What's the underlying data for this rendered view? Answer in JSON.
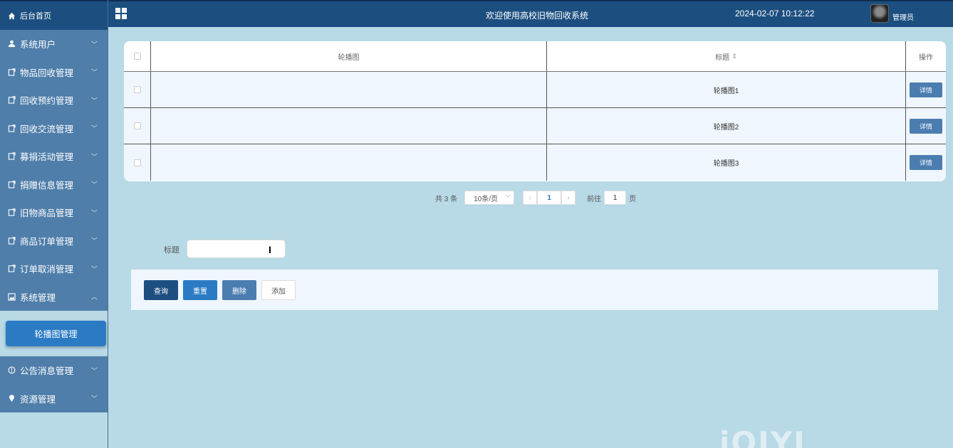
{
  "sidebar": {
    "home_label": "后台首页",
    "items": [
      {
        "label": "系统用户",
        "icon": "user-icon"
      },
      {
        "label": "物品回收管理",
        "icon": "doc-icon"
      },
      {
        "label": "回收预约管理",
        "icon": "doc-icon"
      },
      {
        "label": "回收交流管理",
        "icon": "doc-icon"
      },
      {
        "label": "募捐活动管理",
        "icon": "doc-icon"
      },
      {
        "label": "捐赠信息管理",
        "icon": "doc-icon"
      },
      {
        "label": "旧物商品管理",
        "icon": "doc-icon"
      },
      {
        "label": "商品订单管理",
        "icon": "doc-icon"
      },
      {
        "label": "订单取消管理",
        "icon": "doc-icon"
      },
      {
        "label": "系统管理",
        "icon": "image-icon"
      }
    ],
    "sub_active": "轮播图管理",
    "items_after": [
      {
        "label": "公告消息管理",
        "icon": "info-icon"
      },
      {
        "label": "资源管理",
        "icon": "pin-icon"
      }
    ]
  },
  "header": {
    "title": "欢迎使用高校旧物回收系统",
    "datetime": "2024-02-07 10:12:22",
    "user": "管理员"
  },
  "table": {
    "columns": [
      "轮播图",
      "标题",
      "操作"
    ],
    "rows": [
      {
        "title": "轮播图1",
        "action": "详情"
      },
      {
        "title": "轮播图2",
        "action": "详情"
      },
      {
        "title": "轮播图3",
        "action": "详情"
      }
    ]
  },
  "pagination": {
    "total": "共 3 条",
    "page_size": "10条/页",
    "current": "1",
    "goto_label": "前往",
    "goto_value": "1",
    "page_unit": "页"
  },
  "search": {
    "label": "标题"
  },
  "actions": {
    "query": "查询",
    "reset": "重置",
    "delete": "删除",
    "add": "添加"
  },
  "watermark": "iQIYI",
  "colors": {
    "header_bg": "#1c4f80",
    "menu_bg": "#4f7eaa",
    "page_bg": "#b8d9e6",
    "active_blue": "#2a7bc4"
  }
}
